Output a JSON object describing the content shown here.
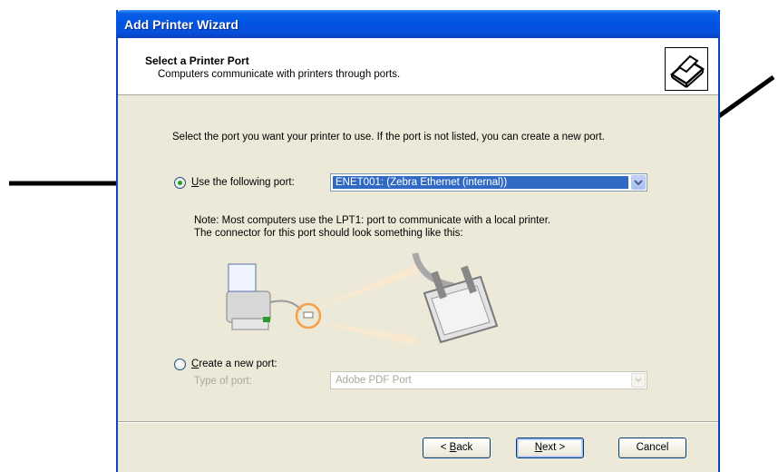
{
  "window": {
    "title": "Add Printer Wizard"
  },
  "header": {
    "title": "Select a Printer Port",
    "subtitle": "Computers communicate with printers through ports."
  },
  "instruction": "Select the port you want your printer to use.  If the port is not listed, you can create a new port.",
  "option_existing": {
    "label_mnemonic": "U",
    "label_rest": "se the following port:",
    "selected_port": "ENET001: (Zebra Ethernet (internal))",
    "checked": true
  },
  "note": {
    "line1": "Note: Most computers use the LPT1: port to communicate with a local printer.",
    "line2": "The connector for this port should look something like this:"
  },
  "option_new": {
    "label_mnemonic": "C",
    "label_rest": "reate a new port:",
    "type_label": "Type of port:",
    "type_value": "Adobe PDF Port",
    "checked": false
  },
  "buttons": {
    "back": {
      "prefix": "< ",
      "mnemonic": "B",
      "rest": "ack"
    },
    "next": {
      "mnemonic": "N",
      "rest": "ext >"
    },
    "cancel": "Cancel"
  },
  "colors": {
    "title_bar": "#0054e3",
    "selection": "#316ac5",
    "window_bg": "#ece9d8"
  }
}
